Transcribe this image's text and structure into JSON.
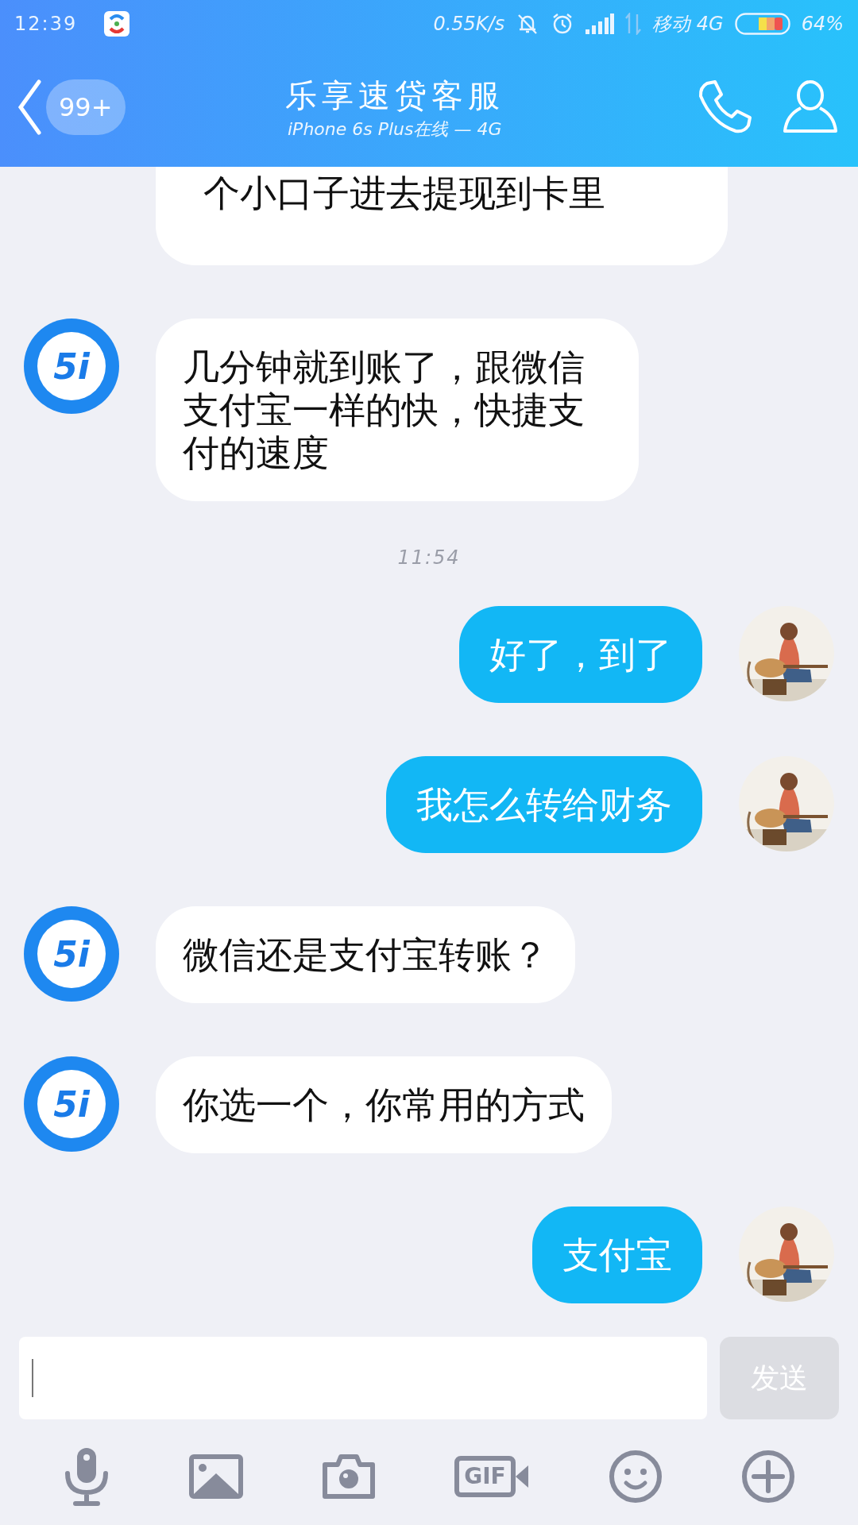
{
  "status_bar": {
    "time": "12:39",
    "speed": "0.55K/s",
    "carrier": "移动 4G",
    "battery": "64%"
  },
  "header": {
    "badge": "99+",
    "title": "乐享速贷客服",
    "subtitle": "iPhone 6s Plus在线 — 4G"
  },
  "messages": [
    {
      "kind": "partial",
      "text": "个小口子进去提现到卡里"
    },
    {
      "kind": "received",
      "avatar": "5i",
      "text": "几分钟就到账了，跟微信支付宝一样的快，快捷支付的速度"
    },
    {
      "kind": "time",
      "text": "11:54"
    },
    {
      "kind": "sent",
      "text": "好了，到了"
    },
    {
      "kind": "sent",
      "text": "我怎么转给财务"
    },
    {
      "kind": "received",
      "avatar": "5i",
      "text": "微信还是支付宝转账？"
    },
    {
      "kind": "received",
      "avatar": "5i",
      "text": "你选一个，你常用的方式"
    },
    {
      "kind": "sent",
      "text": "支付宝"
    }
  ],
  "composer": {
    "send_label": "发送",
    "send_disabled": true
  },
  "toolbar": {
    "gif_label": "GIF"
  }
}
